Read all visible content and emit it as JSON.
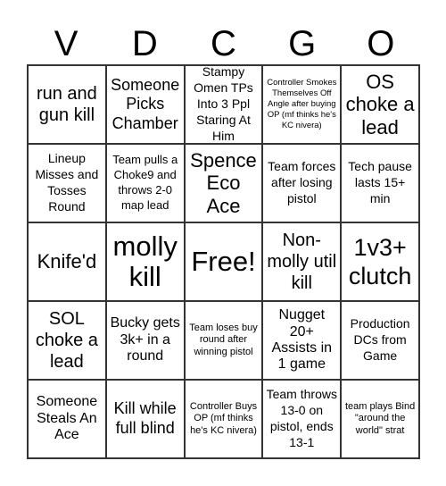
{
  "header": {
    "letters": [
      "V",
      "D",
      "C",
      "G",
      "O"
    ]
  },
  "cells": [
    "run and gun kill",
    "Someone Picks Chamber",
    "Stampy Omen TPs Into 3 Ppl Staring At Him",
    "Controller Smokes Themselves Off Angle after buying OP (mf thinks he's KC nivera)",
    "OS choke a lead",
    "Lineup Misses and Tosses Round",
    "Team pulls a Choke9 and throws 2-0 map lead",
    "Spence Eco Ace",
    "Team forces after losing pistol",
    "Tech pause lasts 15+ min",
    "Knife'd",
    "molly kill",
    "Free!",
    "Non-molly util kill",
    "1v3+ clutch",
    "SOL choke a lead",
    "Bucky gets 3k+ in a round",
    "Team loses buy round after winning pistol",
    "Nugget 20+ Assists in 1 game",
    "Production DCs from Game",
    "Someone Steals An Ace",
    "Kill while full blind",
    "Controller Buys OP (mf thinks he's KC nivera)",
    "Team throws 13-0 on pistol, ends 13-1",
    "team plays Bind \"around the world\" strat"
  ]
}
